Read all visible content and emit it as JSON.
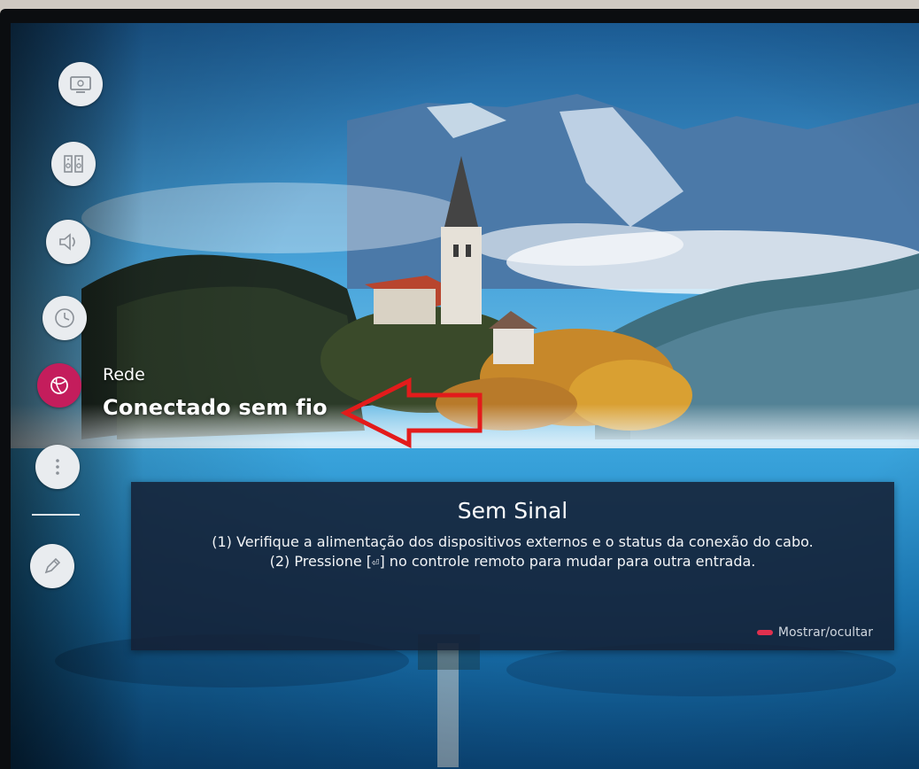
{
  "sidebar": {
    "items": [
      {
        "icon": "picture-settings-icon"
      },
      {
        "icon": "speaker-output-icon"
      },
      {
        "icon": "sound-icon"
      },
      {
        "icon": "clock-icon"
      },
      {
        "icon": "network-globe-icon",
        "active": true
      },
      {
        "icon": "more-options-icon"
      },
      {
        "icon": "edit-pencil-icon"
      }
    ],
    "network": {
      "label": "Rede",
      "status": "Conectado sem fio"
    }
  },
  "dialog": {
    "title": "Sem Sinal",
    "line1": "(1) Verifique a alimentação dos dispositivos externos e o status da conexão do cabo.",
    "line2_prefix": "(2) Pressione [",
    "line2_key": "⏎",
    "line2_suffix": "] no controle remoto para mudar para outra entrada.",
    "toggle_label": "Mostrar/ocultar"
  },
  "colors": {
    "active_accent": "#c41d5c",
    "annotation_arrow": "#e31b1b",
    "dialog_bg": "#14203a",
    "toggle_key": "#e0304e"
  }
}
